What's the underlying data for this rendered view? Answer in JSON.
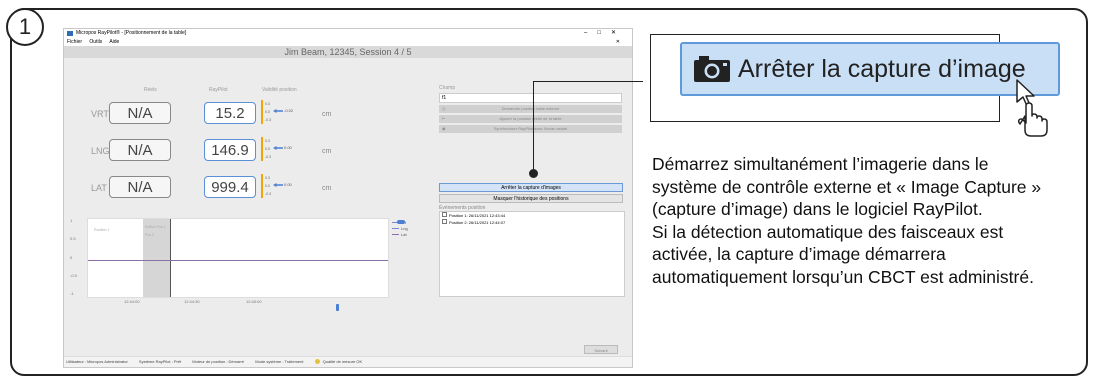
{
  "step_number": "1",
  "window": {
    "title": "Micropos RayPilot® - [Positionnement de la table]",
    "menu": [
      "Fichier",
      "Outils",
      "Aide"
    ],
    "patient_header": "Jim Beam, 12345, Session 4 / 5"
  },
  "table": {
    "col_reels": "Réels",
    "col_raypilot": "RayPilot",
    "col_validite": "Validité position",
    "rows": [
      {
        "label": "VRT",
        "reel": "N/A",
        "raypilot": "15.2",
        "offset": "-0.02",
        "unit": "cm"
      },
      {
        "label": "LNG",
        "reel": "N/A",
        "raypilot": "146.9",
        "offset": "0.00",
        "unit": "cm"
      },
      {
        "label": "LAT",
        "reel": "N/A",
        "raypilot": "999.4",
        "offset": "0.00",
        "unit": "cm"
      }
    ],
    "gauge_ticks": [
      "0.3",
      "0.0",
      "-0.3"
    ]
  },
  "graph": {
    "y_ticks": [
      "1",
      "0.5",
      "0",
      "-0.5",
      "-1"
    ],
    "x_ticks": [
      "12:44:00",
      "12:44:30",
      "12:45:00"
    ],
    "band_labels": [
      "Position 1",
      "Edition Pos 1",
      "Pos 2"
    ],
    "legend": [
      "Vrt",
      "Lng",
      "Lat"
    ]
  },
  "right_panel": {
    "champ_label": "Champ",
    "champ_value": "f1",
    "btn_1": "Demander position table externe",
    "btn_2": "Ajouter la position réelle de la table",
    "btn_3": "Synchroniser RayPilot avec l'écran actuel",
    "stop_capture": "Arrêter la capture d'images",
    "hide_history": "Masquer l'historique des positions",
    "events_title": "Événements position",
    "events": [
      "Position 1: 26/11/2021 12:43:44",
      "Position 2: 26/11/2021 12:44:07"
    ],
    "next_btn": "Suivant"
  },
  "statusbar": {
    "user": "Utilisateur : Micropos Administrator",
    "system": "Système RayPilot : Prêt",
    "motor": "Moteur de position : Démarré",
    "mode": "Mode système : Traitement",
    "quality": "Qualité de mesure OK"
  },
  "zoom": {
    "button_label": "Arrêter la capture d’image",
    "icon": "camera-icon",
    "cursor": "pointer-cursor-icon"
  },
  "description": [
    "Démarrez simultanément l’imagerie dans le système de contrôle externe et « Image Capture » (capture d’image) dans le logiciel RayPilot.",
    "Si la détection automatique des faisceaux est activée, la capture d’image démarrera automatiquement lorsqu’un CBCT est administré."
  ],
  "colors": {
    "accent_blue": "#5e9ad9",
    "button_fill": "#c9dff5",
    "gauge_orange": "#f2a500"
  }
}
